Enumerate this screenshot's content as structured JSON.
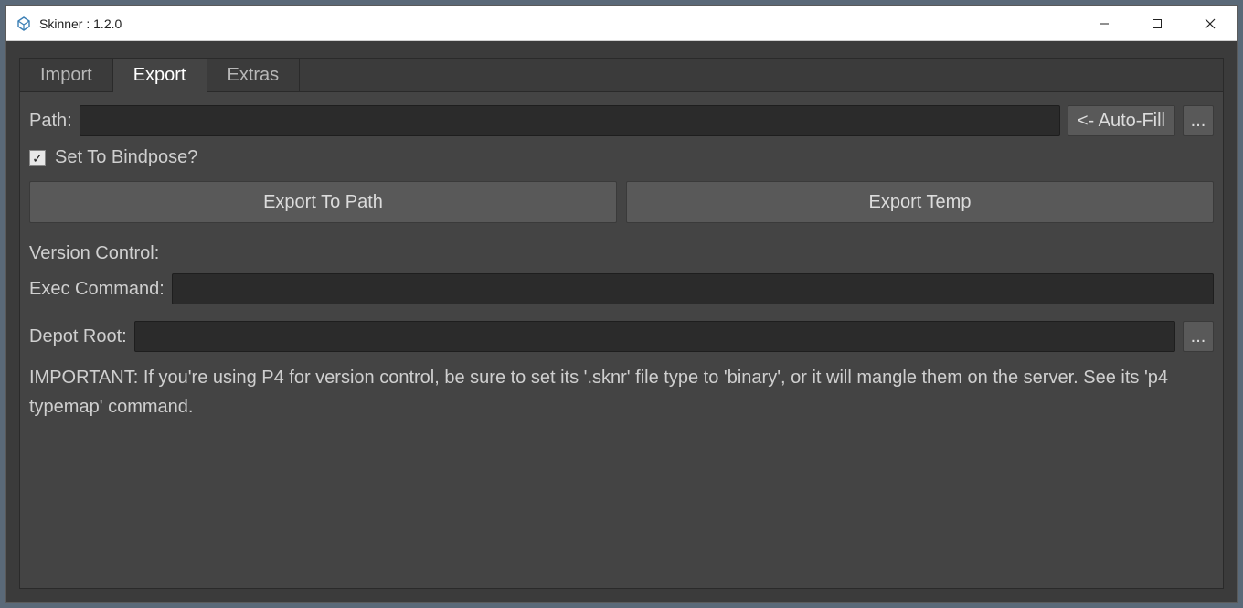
{
  "window": {
    "title": "Skinner : 1.2.0"
  },
  "tabs": {
    "import": "Import",
    "export": "Export",
    "extras": "Extras",
    "active": "export"
  },
  "export": {
    "path_label": "Path:",
    "path_value": "",
    "autofill_label": "<- Auto-Fill",
    "browse_label": "...",
    "bindpose_label": "Set To Bindpose?",
    "bindpose_checked": true,
    "export_to_path_label": "Export To Path",
    "export_temp_label": "Export Temp",
    "version_control_label": "Version Control:",
    "exec_command_label": "Exec Command:",
    "exec_command_value": "",
    "depot_root_label": "Depot Root:",
    "depot_root_value": "",
    "depot_browse_label": "...",
    "note": "IMPORTANT: If you're using P4 for version control, be sure to set its '.sknr' file type to 'binary', or it will mangle them on the server. See its 'p4 typemap' command."
  }
}
